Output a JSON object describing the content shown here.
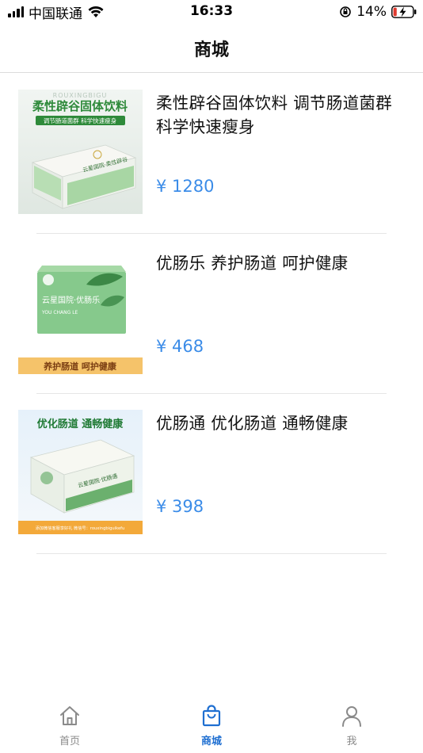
{
  "status_bar": {
    "carrier": "中国联通",
    "time": "16:33",
    "battery_percent": "14%",
    "icons": [
      "signal-icon",
      "wifi-icon",
      "orientation-lock-icon",
      "battery-charging-icon"
    ]
  },
  "nav": {
    "title": "商城"
  },
  "products": [
    {
      "name": "柔性辟谷固体饮料 调节肠道菌群 科学快速瘦身",
      "price": "¥ 1280",
      "image": {
        "top_text": "柔性辟谷固体饮料",
        "sub_text": "调节肠道菌群 科学快速瘦身",
        "watermark": "ROUXINGBIGU",
        "box_text": "云星国院·柔性辟谷"
      }
    },
    {
      "name": "优肠乐 养护肠道 呵护健康",
      "price": "¥ 468",
      "image": {
        "box_text": "云星国院·优肠乐",
        "box_sub_text": "YOU CHANG LE",
        "banner_text": "养护肠道  呵护健康"
      }
    },
    {
      "name": "优肠通 优化肠道 通畅健康",
      "price": "¥ 398",
      "image": {
        "top_text": "优化肠道  通畅健康",
        "box_text": "云星国院·优肠通",
        "footer_text": "添加微信客服享好礼 微信号：rouxingbiguikefu"
      }
    }
  ],
  "tabs": [
    {
      "label": "首页",
      "icon": "home-icon",
      "active": false
    },
    {
      "label": "商城",
      "icon": "shopping-bag-icon",
      "active": true
    },
    {
      "label": "我",
      "icon": "person-icon",
      "active": false
    }
  ],
  "colors": {
    "price": "#3b8ce8",
    "tab_active": "#1f6fd1",
    "tab_inactive": "#8a8a8a",
    "product1_green": "#2e8a3a",
    "product2_banner": "#f5c36a",
    "product3_footer": "#f3a93a"
  }
}
